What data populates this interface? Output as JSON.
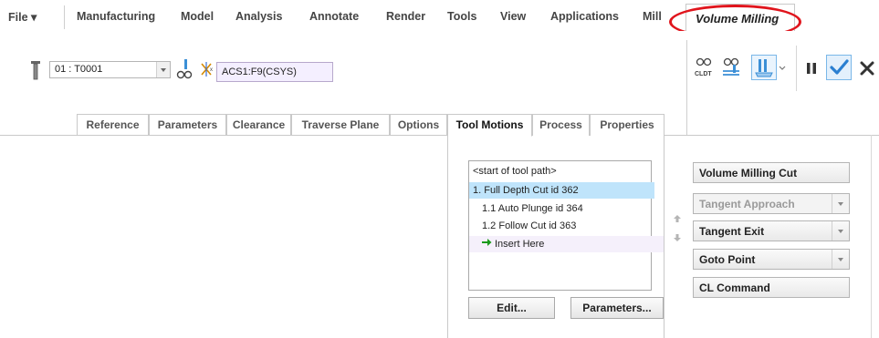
{
  "menu": {
    "file": "File ▾",
    "manufacturing": "Manufacturing",
    "model": "Model",
    "analysis": "Analysis",
    "annotate": "Annotate",
    "render": "Render",
    "tools": "Tools",
    "view": "View",
    "applications": "Applications",
    "mill": "Mill",
    "volume_milling": "Volume Milling"
  },
  "ribbon": {
    "tool_value": "01 : T0001",
    "csys_value": "ACS1:F9(CSYS)"
  },
  "subtabs": [
    "Reference",
    "Parameters",
    "Clearance",
    "Traverse Plane",
    "Options",
    "Tool Motions",
    "Process",
    "Properties"
  ],
  "active_subtab": "Tool Motions",
  "right_toolbar": {
    "cldt_label": "CLDT"
  },
  "tool_motions": {
    "items": [
      "<start of tool path>",
      "1. Full Depth Cut id 362",
      "1.1 Auto Plunge id 364",
      "1.2 Follow Cut id 363",
      "Insert Here"
    ],
    "edit_button": "Edit...",
    "parameters_button": "Parameters...",
    "volume_milling_cut": "Volume Milling Cut",
    "tangent_approach": "Tangent Approach",
    "tangent_exit": "Tangent Exit",
    "goto_point": "Goto Point",
    "cl_command": "CL Command"
  },
  "colors": {
    "highlight_ring": "#e0141c",
    "selection": "#bfe4fb",
    "check": "#2a7fd1"
  }
}
